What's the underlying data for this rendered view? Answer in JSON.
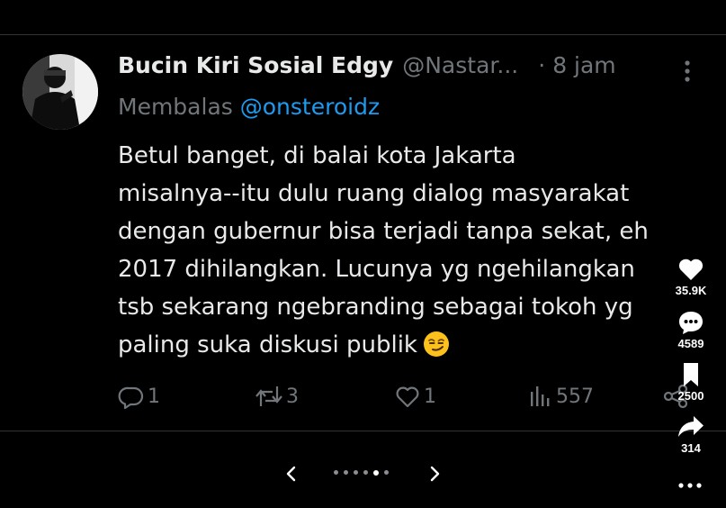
{
  "tweet": {
    "display_name": "Bucin Kiri Sosial Edgy",
    "handle": "@Nastar...",
    "dot": "·",
    "time": "8 jam",
    "reply_prefix": "Membalas",
    "reply_mention": "@onsteroidz",
    "text_lines": [
      "Betul banget, di balai kota Jakarta",
      "misalnya--itu dulu ruang dialog masyarakat",
      "dengan gubernur bisa terjadi tanpa sekat, eh",
      "2017 dihilangkan. Lucunya yg ngehilangkan",
      "tsb sekarang ngebranding sebagai tokoh yg",
      "paling suka diskusi publik"
    ],
    "emoji": "smirk"
  },
  "actions": {
    "reply_count": "1",
    "retweet_count": "3",
    "like_count": "1",
    "views_count": "557"
  },
  "overlay": {
    "likes": "35.9K",
    "comments": "4589",
    "bookmarks": "2500",
    "shares": "314"
  },
  "pager": {
    "dot_count": 6,
    "active_index": 4
  },
  "colors": {
    "background": "#000000",
    "text": "#e7e9ea",
    "muted": "#71767b",
    "link": "#1d9bf0"
  }
}
